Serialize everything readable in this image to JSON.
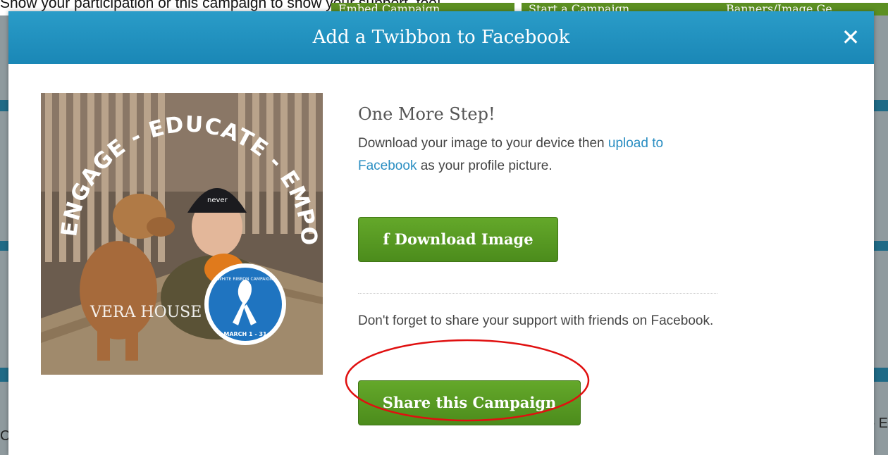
{
  "background": {
    "top_text": "Show your participation or this campaign to show your support, too!",
    "buttons": [
      "Embed Campaign",
      "Start a Campaign",
      "Banners/Image Ge"
    ],
    "right_fragment": "- E",
    "left_fragment": "C"
  },
  "modal": {
    "title": "Add a Twibbon to Facebook",
    "close_glyph": "✕",
    "heading": "One More Step!",
    "desc_before": "Download your image to your device then ",
    "desc_link": "upload to Facebook",
    "desc_after": " as your profile picture.",
    "download_icon": "f",
    "download_label": "Download Image",
    "note": "Don't forget to share your support with friends on Facebook.",
    "share_label": "Share this Campaign"
  },
  "image": {
    "arc_text": "ENGAGE - EDUCATE - EMPOWER",
    "brand": "VERA HOUSE",
    "badge_top": "WHITE RIBBON CAMPAIGN",
    "badge_bottom": "MARCH 1 - 31",
    "hat_text": "never",
    "colors": {
      "badge": "#1f74c0",
      "arc_text": "#ffffff"
    }
  },
  "colors": {
    "header": "#1f90bf",
    "button": "#58991f",
    "link": "#2a8ec2",
    "annotation": "#e01010"
  }
}
